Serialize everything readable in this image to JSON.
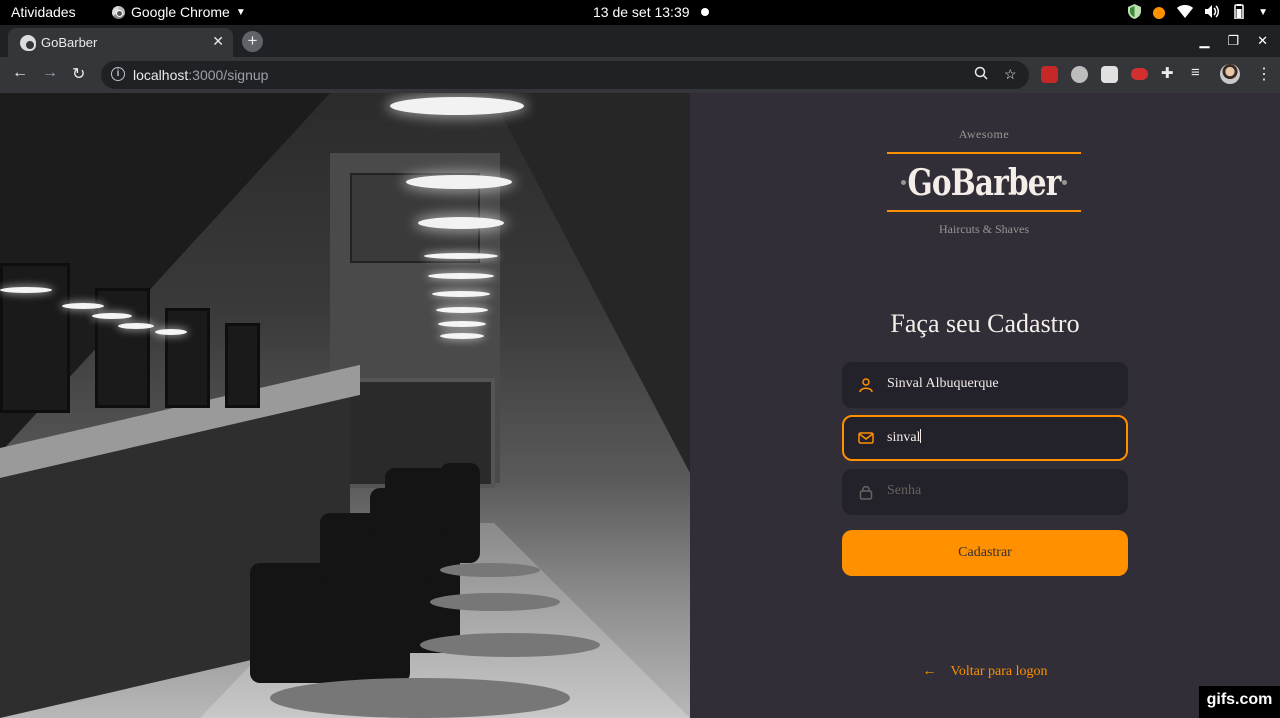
{
  "system_bar": {
    "activities": "Atividades",
    "app_name": "Google Chrome",
    "clock": "13 de set  13:39",
    "icons": [
      "shield-icon",
      "notification-dot-icon",
      "wifi-icon",
      "volume-icon",
      "battery-icon",
      "chevron-down-icon"
    ],
    "accent_color": "#ff9000"
  },
  "browser": {
    "tab_title": "GoBarber",
    "url_host": "localhost",
    "url_path": ":3000/signup"
  },
  "page": {
    "colors": {
      "background": "#312e38",
      "accent": "#ff9000",
      "input_bg": "#232129",
      "text": "#f4ede8",
      "placeholder": "#666360"
    },
    "logo": {
      "tagline_top": "Awesome",
      "wordmark": "GoBarber",
      "tagline_bottom": "Haircuts & Shaves"
    },
    "heading": "Faça seu Cadastro",
    "form": {
      "name": {
        "value": "Sinval Albuquerque",
        "icon": "user-icon"
      },
      "email": {
        "value": "sinval",
        "icon": "mail-icon"
      },
      "password": {
        "placeholder": "Senha",
        "icon": "lock-icon"
      },
      "submit_label": "Cadastrar"
    },
    "back_link": "Voltar para logon"
  },
  "watermark": "gifs.com"
}
